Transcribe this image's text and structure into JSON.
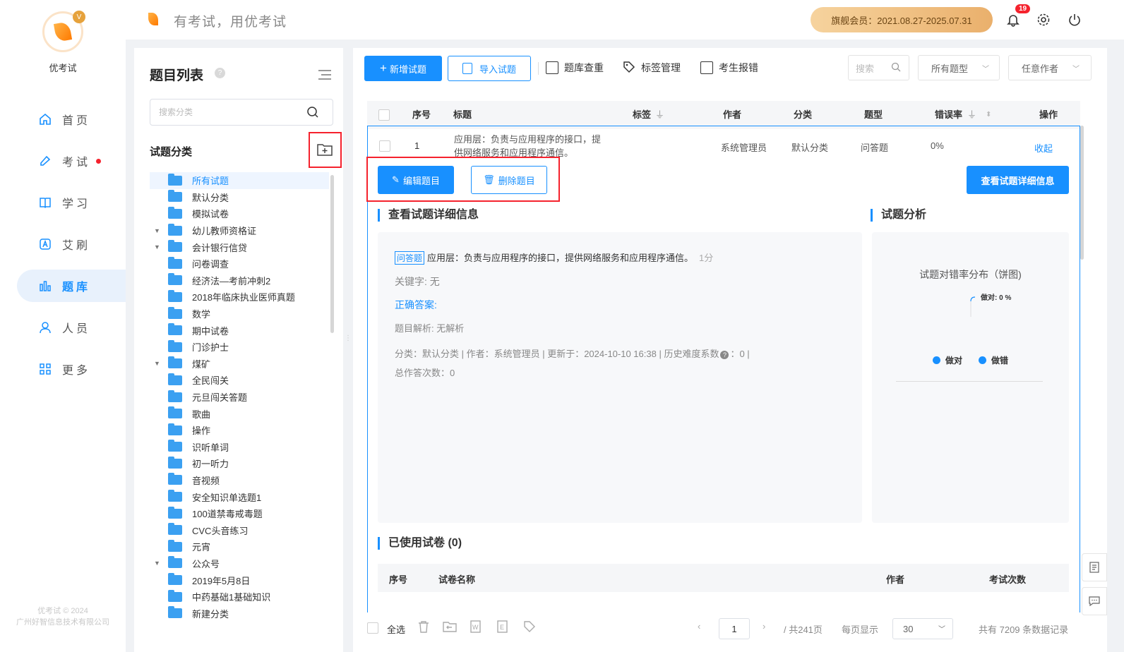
{
  "app": {
    "name": "优考试",
    "slogan": "有考试，用优考试",
    "copyright_line1": "优考试 © 2024",
    "copyright_line2": "广州好智信息技术有限公司"
  },
  "nav": [
    {
      "label": "首页",
      "icon": "home-icon"
    },
    {
      "label": "考试",
      "icon": "exam-icon"
    },
    {
      "label": "学习",
      "icon": "book-icon"
    },
    {
      "label": "艾刷",
      "icon": "a-icon"
    },
    {
      "label": "题库",
      "icon": "bar-chart-icon"
    },
    {
      "label": "人员",
      "icon": "user-icon"
    },
    {
      "label": "更多",
      "icon": "apps-icon"
    }
  ],
  "header": {
    "vip": "旗舰会员：2021.08.27-2025.07.31",
    "notifications": "19"
  },
  "catpanel": {
    "title": "题目列表",
    "search_placeholder": "搜索分类",
    "category_label": "试题分类",
    "tree": [
      {
        "label": "所有试题",
        "sel": true,
        "caret": false
      },
      {
        "label": "默认分类",
        "caret": false
      },
      {
        "label": "模拟试卷",
        "caret": false
      },
      {
        "label": "幼儿教师资格证",
        "caret": true
      },
      {
        "label": "会计银行信贷",
        "caret": true
      },
      {
        "label": "问卷调查",
        "caret": false
      },
      {
        "label": "经济法—考前冲刺2",
        "caret": false
      },
      {
        "label": "2018年临床执业医师真题",
        "caret": false
      },
      {
        "label": "数学",
        "caret": false
      },
      {
        "label": "期中试卷",
        "caret": false
      },
      {
        "label": "门诊护士",
        "caret": false
      },
      {
        "label": "煤矿",
        "caret": true
      },
      {
        "label": "全民闯关",
        "caret": false
      },
      {
        "label": "元旦闯关答题",
        "caret": false
      },
      {
        "label": "歌曲",
        "caret": false
      },
      {
        "label": "操作",
        "caret": false
      },
      {
        "label": "识听单词",
        "caret": false
      },
      {
        "label": "初一听力",
        "caret": false
      },
      {
        "label": "音视频",
        "caret": false
      },
      {
        "label": "安全知识单选题1",
        "caret": false
      },
      {
        "label": "100道禁毒戒毒题",
        "caret": false
      },
      {
        "label": "CVC头音练习",
        "caret": false
      },
      {
        "label": "元宵",
        "caret": false
      },
      {
        "label": "公众号",
        "caret": true
      },
      {
        "label": "2019年5月8日",
        "caret": false
      },
      {
        "label": "中药基础1基础知识",
        "caret": false
      },
      {
        "label": "新建分类",
        "caret": false
      }
    ]
  },
  "toolbar": {
    "add": "新增试题",
    "import": "导入试题",
    "dup": "题库查重",
    "tags": "标签管理",
    "report": "考生报错",
    "search_placeholder": "搜索",
    "type_select": "所有题型",
    "author_select": "任意作者"
  },
  "table": {
    "headers": {
      "no": "序号",
      "title": "标题",
      "tag": "标签",
      "author": "作者",
      "cat": "分类",
      "type": "题型",
      "err": "错误率",
      "op": "操作"
    },
    "row": {
      "no": "1",
      "title_l1": "应用层：负责与应用程序的接口，提",
      "title_l2": "供网络服务和应用程序通信。",
      "author": "系统管理员",
      "cat": "默认分类",
      "type": "问答题",
      "err": "0%",
      "op": "收起"
    }
  },
  "detail": {
    "edit": "编辑题目",
    "delete": "删除题目",
    "view": "查看试题详细信息",
    "sec_info": "查看试题详细信息",
    "sec_analysis": "试题分析",
    "qtype": "问答题",
    "qtext": "应用层：负责与应用程序的接口，提供网络服务和应用程序通信。",
    "score": "1分",
    "keywords": "关键字: 无",
    "answer_label": "正确答案:",
    "explain": "题目解析:   无解析",
    "meta": "分类：默认分类 | 作者：系统管理员 | 更新于：2024-10-10 16:38 | 历史难度系数",
    "meta_tail": "：0 |",
    "total": "总作答次数：0",
    "chart_title": "试题对错率分布（饼图)",
    "pie_label": "做对: 0 %",
    "legend_right": "做对",
    "legend_wrong": "做错",
    "used_title": "已使用试卷",
    "used_count": "(0)",
    "used_headers": {
      "no": "序号",
      "name": "试卷名称",
      "author": "作者",
      "times": "考试次数"
    }
  },
  "chart_data": {
    "type": "pie",
    "title": "试题对错率分布（饼图)",
    "categories": [
      "做对",
      "做错"
    ],
    "values": [
      0,
      0
    ],
    "labels": [
      "做对: 0 %"
    ]
  },
  "footer": {
    "select_all": "全选",
    "page": "1",
    "total_pages": "/ 共241页",
    "per_page_label": "每页显示",
    "per_page": "30",
    "total_records": "共有 7209 条数据记录"
  },
  "colors": {
    "accent": "#1890ff",
    "highlight": "#f5222d"
  }
}
